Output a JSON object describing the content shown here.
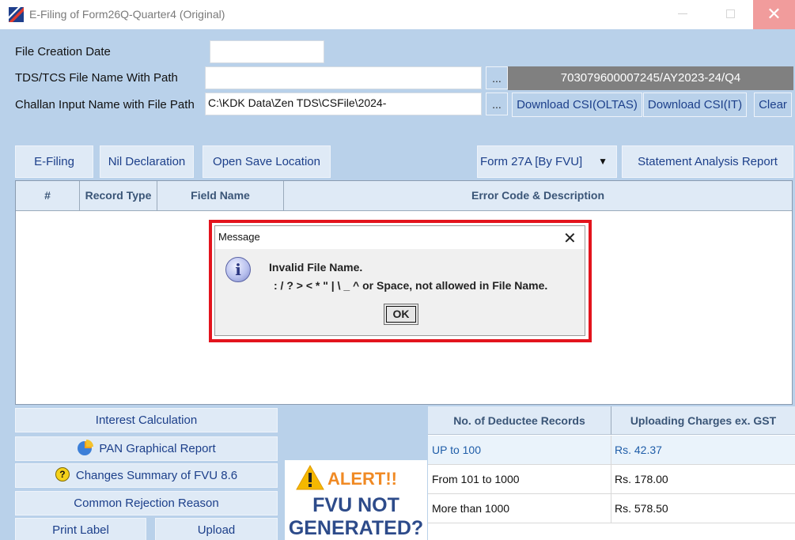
{
  "window": {
    "title": "E-Filing of Form26Q-Quarter4 (Original)",
    "close_glyph": "✕"
  },
  "form": {
    "file_creation_date_label": "File Creation Date",
    "file_creation_date_value": "",
    "tds_file_label": "TDS/TCS File Name With Path",
    "tds_file_value": "",
    "challan_label": "Challan Input Name with File Path",
    "challan_value": "C:\\KDK Data\\Zen TDS\\CSFile\\2024-",
    "browse_label": "...",
    "token": "703079600007245/AY2023-24/Q4",
    "download_oltas": "Download CSI(OLTAS)",
    "download_it": "Download CSI(IT)",
    "clear": "Clear"
  },
  "toolbar": {
    "efiling": "E-Filing",
    "nil_declaration": "Nil Declaration",
    "open_save_location": "Open Save Location",
    "form27a_selected": "Form 27A [By FVU]",
    "statement_analysis": "Statement Analysis Report"
  },
  "grid": {
    "columns": [
      "#",
      "Record Type",
      "Field Name",
      "Error Code & Description"
    ]
  },
  "dialog": {
    "title": "Message",
    "close_glyph": "✕",
    "line1": "Invalid File Name.",
    "line2": ": / ? > < * \" | \\ _ ^ or Space, not allowed in File Name.",
    "ok": "OK",
    "icon": "info-icon"
  },
  "bottom_left": {
    "interest_calculation": "Interest Calculation",
    "pan_graphical_report": "PAN Graphical Report",
    "changes_summary": "Changes Summary of FVU 8.6",
    "common_rejection": "Common Rejection Reason",
    "print_label": "Print Label",
    "upload": "Upload"
  },
  "alert": {
    "word": "ALERT!!",
    "line1": "FVU NOT",
    "line2": "GENERATED?"
  },
  "charges": {
    "headers": [
      "No. of Deductee Records",
      "Uploading Charges ex. GST"
    ],
    "rows": [
      {
        "records": "UP to 100",
        "charge": "Rs. 42.37"
      },
      {
        "records": "From 101 to 1000",
        "charge": "Rs. 178.00"
      },
      {
        "records": "More than 1000",
        "charge": "Rs. 578.50"
      }
    ]
  },
  "colors": {
    "background": "#b9d1ea",
    "highlight": "#e3141d",
    "alert_orange": "#f08a24",
    "link_blue": "#1c3f8a"
  }
}
